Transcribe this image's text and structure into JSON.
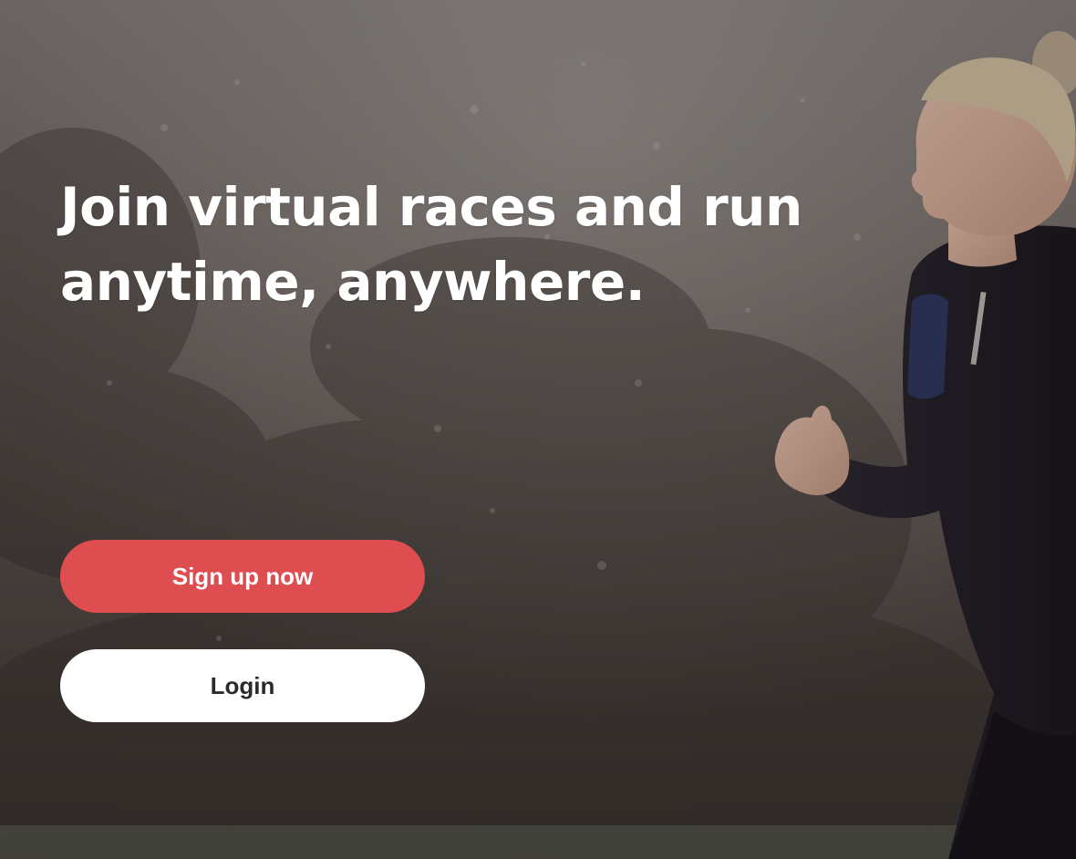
{
  "hero": {
    "headline_line1": "Join virtual races and run",
    "headline_line2": "anytime, anywhere."
  },
  "actions": {
    "signup_label": "Sign up now",
    "login_label": "Login"
  },
  "colors": {
    "primary": "#de4d50",
    "secondary_bg": "#ffffff",
    "secondary_text": "#2b2b2b",
    "headline_text": "#ffffff"
  },
  "background": {
    "subject": "woman-jogging-photo"
  }
}
